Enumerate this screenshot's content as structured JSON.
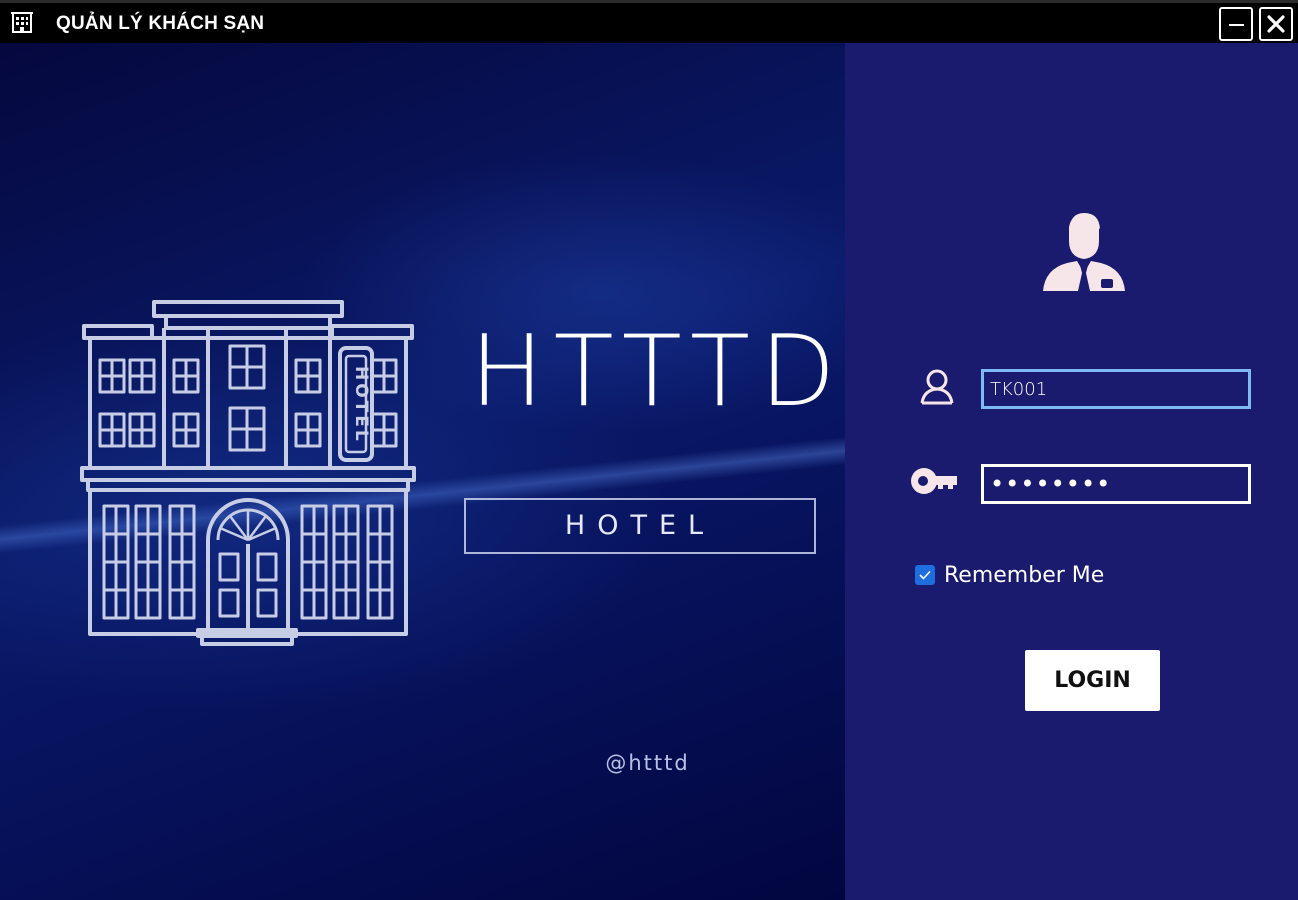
{
  "window": {
    "title": "QUẢN LÝ KHÁCH SẠN",
    "app_icon": "hotel-building-icon",
    "controls": {
      "minimize_icon": "minimize-icon",
      "close_icon": "close-icon"
    }
  },
  "brand": {
    "title": "HTTTD",
    "subtitle": "HOTEL",
    "handle": "@htttd",
    "illustration_sign": "HOTEL",
    "illustration_icon": "hotel-building-illustration"
  },
  "login": {
    "avatar_icon": "user-avatar-icon",
    "username_icon": "user-icon",
    "username_value": "TK001",
    "password_icon": "key-icon",
    "password_value": "12345678",
    "remember_label": "Remember Me",
    "remember_checked": true,
    "login_label": "LOGIN"
  },
  "colors": {
    "titlebar": "#000000",
    "left_panel": "#0a1a6a",
    "right_panel": "#1a1a6e",
    "username_border": "#7db9f2",
    "checkbox": "#1e6ee0"
  }
}
